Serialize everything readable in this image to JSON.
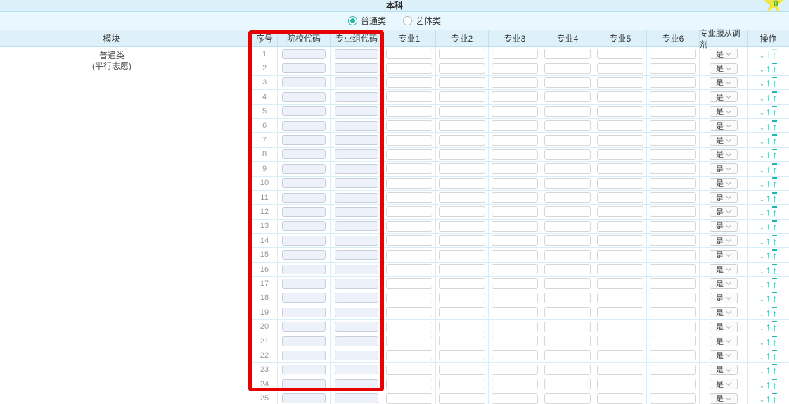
{
  "title": "本科",
  "badge": {
    "count": "0",
    "star_color": "#f2e63e",
    "count_color": "#4fae35"
  },
  "categories": [
    {
      "label": "普通类",
      "selected": true
    },
    {
      "label": "艺体类",
      "selected": false
    }
  ],
  "table": {
    "module_column_header": "模块",
    "module_label": {
      "line1": "普通类",
      "line2": "(平行志愿)"
    },
    "columns": [
      "序号",
      "院校代码",
      "专业组代码",
      "专业1",
      "专业2",
      "专业3",
      "专业4",
      "专业5",
      "专业6",
      "专业服从调剂",
      "操作"
    ],
    "highlight_border_color": "#e60000",
    "accent_color": "#29b2aa",
    "actions": [
      {
        "name": "move-down-icon",
        "glyph": "↓",
        "bar": false
      },
      {
        "name": "move-up-icon",
        "glyph": "↑",
        "bar": false
      },
      {
        "name": "move-top-icon",
        "glyph": "↑",
        "bar": true
      }
    ],
    "rows": [
      {
        "num": "1",
        "school_code": "",
        "group_code": "",
        "majors": [
          "",
          "",
          "",
          "",
          "",
          ""
        ],
        "adjust": "是",
        "disabled_actions": [
          "move-up-icon",
          "move-top-icon"
        ]
      },
      {
        "num": "2",
        "school_code": "",
        "group_code": "",
        "majors": [
          "",
          "",
          "",
          "",
          "",
          ""
        ],
        "adjust": "是",
        "disabled_actions": []
      },
      {
        "num": "3",
        "school_code": "",
        "group_code": "",
        "majors": [
          "",
          "",
          "",
          "",
          "",
          ""
        ],
        "adjust": "是",
        "disabled_actions": []
      },
      {
        "num": "4",
        "school_code": "",
        "group_code": "",
        "majors": [
          "",
          "",
          "",
          "",
          "",
          ""
        ],
        "adjust": "是",
        "disabled_actions": []
      },
      {
        "num": "5",
        "school_code": "",
        "group_code": "",
        "majors": [
          "",
          "",
          "",
          "",
          "",
          ""
        ],
        "adjust": "是",
        "disabled_actions": []
      },
      {
        "num": "6",
        "school_code": "",
        "group_code": "",
        "majors": [
          "",
          "",
          "",
          "",
          "",
          ""
        ],
        "adjust": "是",
        "disabled_actions": []
      },
      {
        "num": "7",
        "school_code": "",
        "group_code": "",
        "majors": [
          "",
          "",
          "",
          "",
          "",
          ""
        ],
        "adjust": "是",
        "disabled_actions": []
      },
      {
        "num": "8",
        "school_code": "",
        "group_code": "",
        "majors": [
          "",
          "",
          "",
          "",
          "",
          ""
        ],
        "adjust": "是",
        "disabled_actions": []
      },
      {
        "num": "9",
        "school_code": "",
        "group_code": "",
        "majors": [
          "",
          "",
          "",
          "",
          "",
          ""
        ],
        "adjust": "是",
        "disabled_actions": []
      },
      {
        "num": "10",
        "school_code": "",
        "group_code": "",
        "majors": [
          "",
          "",
          "",
          "",
          "",
          ""
        ],
        "adjust": "是",
        "disabled_actions": []
      },
      {
        "num": "11",
        "school_code": "",
        "group_code": "",
        "majors": [
          "",
          "",
          "",
          "",
          "",
          ""
        ],
        "adjust": "是",
        "disabled_actions": []
      },
      {
        "num": "12",
        "school_code": "",
        "group_code": "",
        "majors": [
          "",
          "",
          "",
          "",
          "",
          ""
        ],
        "adjust": "是",
        "disabled_actions": []
      },
      {
        "num": "13",
        "school_code": "",
        "group_code": "",
        "majors": [
          "",
          "",
          "",
          "",
          "",
          ""
        ],
        "adjust": "是",
        "disabled_actions": []
      },
      {
        "num": "14",
        "school_code": "",
        "group_code": "",
        "majors": [
          "",
          "",
          "",
          "",
          "",
          ""
        ],
        "adjust": "是",
        "disabled_actions": []
      },
      {
        "num": "15",
        "school_code": "",
        "group_code": "",
        "majors": [
          "",
          "",
          "",
          "",
          "",
          ""
        ],
        "adjust": "是",
        "disabled_actions": []
      },
      {
        "num": "16",
        "school_code": "",
        "group_code": "",
        "majors": [
          "",
          "",
          "",
          "",
          "",
          ""
        ],
        "adjust": "是",
        "disabled_actions": []
      },
      {
        "num": "17",
        "school_code": "",
        "group_code": "",
        "majors": [
          "",
          "",
          "",
          "",
          "",
          ""
        ],
        "adjust": "是",
        "disabled_actions": []
      },
      {
        "num": "18",
        "school_code": "",
        "group_code": "",
        "majors": [
          "",
          "",
          "",
          "",
          "",
          ""
        ],
        "adjust": "是",
        "disabled_actions": []
      },
      {
        "num": "19",
        "school_code": "",
        "group_code": "",
        "majors": [
          "",
          "",
          "",
          "",
          "",
          ""
        ],
        "adjust": "是",
        "disabled_actions": []
      },
      {
        "num": "20",
        "school_code": "",
        "group_code": "",
        "majors": [
          "",
          "",
          "",
          "",
          "",
          ""
        ],
        "adjust": "是",
        "disabled_actions": []
      },
      {
        "num": "21",
        "school_code": "",
        "group_code": "",
        "majors": [
          "",
          "",
          "",
          "",
          "",
          ""
        ],
        "adjust": "是",
        "disabled_actions": []
      },
      {
        "num": "22",
        "school_code": "",
        "group_code": "",
        "majors": [
          "",
          "",
          "",
          "",
          "",
          ""
        ],
        "adjust": "是",
        "disabled_actions": []
      },
      {
        "num": "23",
        "school_code": "",
        "group_code": "",
        "majors": [
          "",
          "",
          "",
          "",
          "",
          ""
        ],
        "adjust": "是",
        "disabled_actions": []
      },
      {
        "num": "24",
        "school_code": "",
        "group_code": "",
        "majors": [
          "",
          "",
          "",
          "",
          "",
          ""
        ],
        "adjust": "是",
        "disabled_actions": []
      },
      {
        "num": "25",
        "school_code": "",
        "group_code": "",
        "majors": [
          "",
          "",
          "",
          "",
          "",
          ""
        ],
        "adjust": "是",
        "disabled_actions": []
      }
    ]
  }
}
